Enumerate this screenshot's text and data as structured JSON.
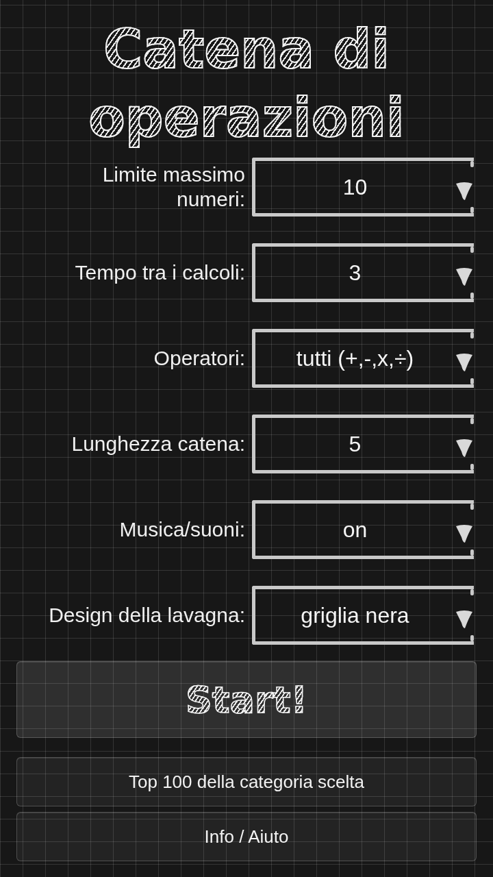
{
  "title": "Catena di operazioni",
  "settings": [
    {
      "label": "Limite massimo numeri:",
      "value": "10"
    },
    {
      "label": "Tempo tra i calcoli:",
      "value": "3"
    },
    {
      "label": "Operatori:",
      "value": "tutti (+,-,x,÷)"
    },
    {
      "label": "Lunghezza catena:",
      "value": "5"
    },
    {
      "label": "Musica/suoni:",
      "value": "on"
    },
    {
      "label": "Design della lavagna:",
      "value": "griglia nera"
    }
  ],
  "buttons": [
    {
      "kind": "primary",
      "label": "Start!"
    },
    {
      "kind": "secondary",
      "label": "Top 100 della categoria scelta"
    },
    {
      "kind": "secondary",
      "label": "Info / Aiuto"
    }
  ]
}
